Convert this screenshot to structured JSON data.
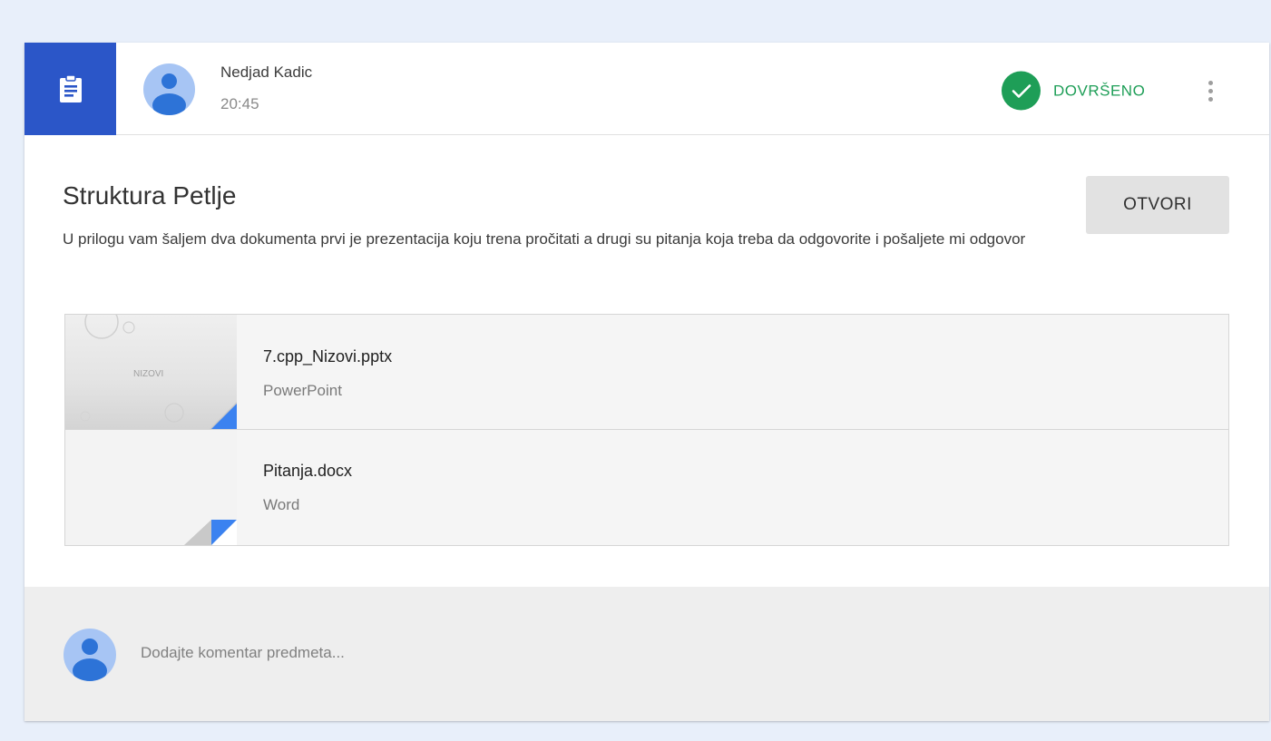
{
  "post": {
    "author": "Nedjad Kadic",
    "time": "20:45",
    "status": "DOVRŠENO",
    "title": "Struktura Petlje",
    "description": "U prilogu vam šaljem dva dokumenta prvi je prezentacija koju trena pročitati a drugi su pitanja koja treba da odgovorite i pošaljete mi odgovor",
    "open_label": "OTVORI"
  },
  "attachments": [
    {
      "name": "7.cpp_Nizovi.pptx",
      "type": "PowerPoint",
      "thumb_text": "NIZOVI",
      "icon": "powerpoint-thumbnail"
    },
    {
      "name": "Pitanja.docx",
      "type": "Word",
      "icon": "word-thumbnail"
    }
  ],
  "comment": {
    "placeholder": "Dodajte komentar predmeta..."
  },
  "colors": {
    "page_background": "#e8effa",
    "accent_blue": "#2b56c8",
    "status_green": "#1e9e57",
    "avatar_light": "#a7c5f4",
    "avatar_dark": "#2d73d7"
  }
}
